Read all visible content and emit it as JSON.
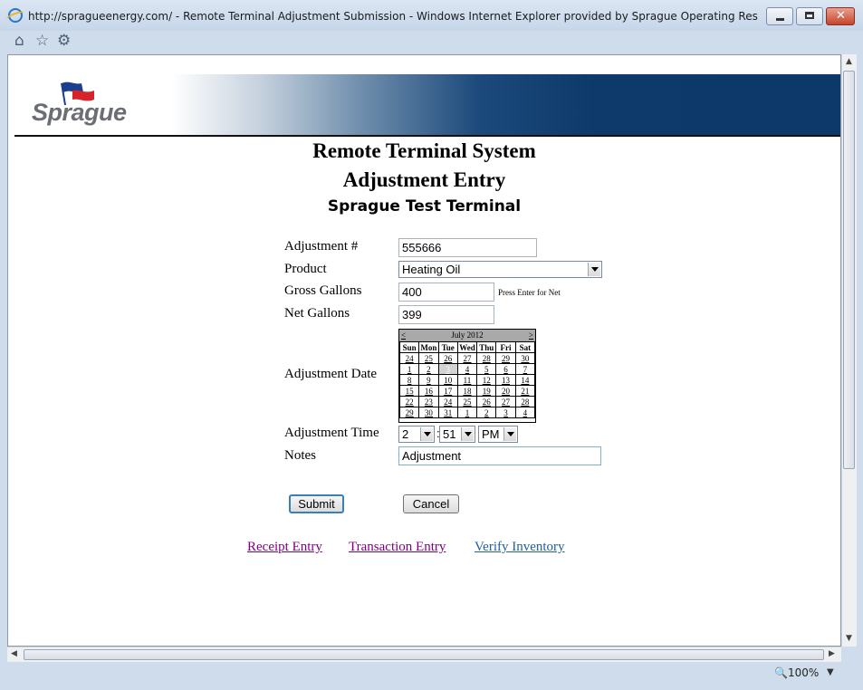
{
  "window": {
    "title": "http://spragueenergy.com/ - Remote Terminal Adjustment Submission - Windows Internet Explorer provided by Sprague Operating Res"
  },
  "logo": {
    "text": "Sprague"
  },
  "page": {
    "title": "Remote Terminal System",
    "subtitle": "Adjustment Entry",
    "terminal": "Sprague Test Terminal"
  },
  "form": {
    "adjustment_no": {
      "label": "Adjustment #",
      "value": "555666"
    },
    "product": {
      "label": "Product",
      "value": "Heating Oil"
    },
    "gross_gallons": {
      "label": "Gross Gallons",
      "value": "400",
      "hint": "Press Enter for Net"
    },
    "net_gallons": {
      "label": "Net Gallons",
      "value": "399"
    },
    "adjustment_date": {
      "label": "Adjustment Date"
    },
    "adjustment_time": {
      "label": "Adjustment Time",
      "hour": "2",
      "minute": "51",
      "ampm": "PM"
    },
    "notes": {
      "label": "Notes",
      "value": "Adjustment"
    }
  },
  "calendar": {
    "month": "July 2012",
    "prev": "<",
    "next": ">",
    "days": [
      "Sun",
      "Mon",
      "Tue",
      "Wed",
      "Thu",
      "Fri",
      "Sat"
    ],
    "selected": "3",
    "weeks": [
      [
        "24",
        "25",
        "26",
        "27",
        "28",
        "29",
        "30"
      ],
      [
        "1",
        "2",
        "3",
        "4",
        "5",
        "6",
        "7"
      ],
      [
        "8",
        "9",
        "10",
        "11",
        "12",
        "13",
        "14"
      ],
      [
        "15",
        "16",
        "17",
        "18",
        "19",
        "20",
        "21"
      ],
      [
        "22",
        "23",
        "24",
        "25",
        "26",
        "27",
        "28"
      ],
      [
        "29",
        "30",
        "31",
        "1",
        "2",
        "3",
        "4"
      ]
    ]
  },
  "buttons": {
    "submit": "Submit",
    "cancel": "Cancel"
  },
  "links": {
    "receipt": "Receipt Entry",
    "transaction": "Transaction Entry",
    "verify": "Verify Inventory"
  },
  "status": {
    "zoom": "100%"
  },
  "colors": {
    "header_navy": "#0c386a",
    "link_visited": "#800080",
    "link": "#1f5fa0"
  }
}
